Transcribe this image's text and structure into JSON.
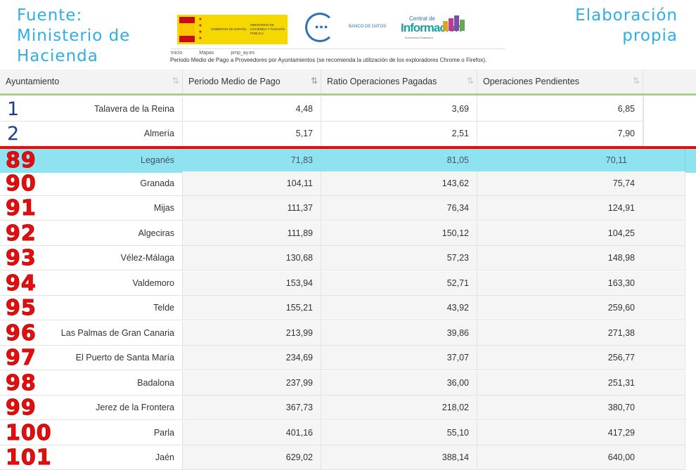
{
  "header": {
    "source_lines": [
      "Fuente:",
      "Ministerio de",
      "Hacienda"
    ],
    "credit_lines": [
      "Elaboración",
      "propia"
    ],
    "gov_logo": {
      "line1": "GOBIERNO DE ESPAÑA",
      "line2": "MINISTERIO DE HACIENDA Y FUNCIÓN PÚBLICA"
    },
    "bank_logo": {
      "label": "BANCO DE DATOS"
    },
    "central_logo": {
      "small": "Central de",
      "big": "Información",
      "sub": "Económico-Financiera"
    },
    "breadcrumbs": [
      "Inicio",
      "Mapas",
      "pmp_ay.es"
    ],
    "subtitle": "Periodo Medio de Pago a Proveedores por Ayuntamientos (se recomienda la utilización de los exploradores Chrome o Firefox)."
  },
  "table": {
    "columns": [
      {
        "label": "Ayuntamiento",
        "sort": "⇅",
        "sort_active": false
      },
      {
        "label": "Periodo Medio de Pago",
        "sort": "⇅",
        "sort_active": true
      },
      {
        "label": "Ratio Operaciones Pagadas",
        "sort": "⇅",
        "sort_active": false
      },
      {
        "label": "Operaciones Pendientes",
        "sort": "⇅",
        "sort_active": false
      }
    ],
    "rows": [
      {
        "rank": "1",
        "name": "Talavera de la Reina",
        "pmp": "4,48",
        "ratio": "3,69",
        "pend": "6,85",
        "style": "top"
      },
      {
        "rank": "2",
        "name": "Almería",
        "pmp": "5,17",
        "ratio": "2,51",
        "pend": "7,90",
        "style": "top"
      },
      {
        "rank": "89",
        "name": "Leganés",
        "pmp": "71,83",
        "ratio": "81,05",
        "pend": "70,11",
        "style": "highlight"
      },
      {
        "rank": "90",
        "name": "Granada",
        "pmp": "104,11",
        "ratio": "143,62",
        "pend": "75,74",
        "style": "red"
      },
      {
        "rank": "91",
        "name": "Mijas",
        "pmp": "111,37",
        "ratio": "76,34",
        "pend": "124,91",
        "style": "red"
      },
      {
        "rank": "92",
        "name": "Algeciras",
        "pmp": "111,89",
        "ratio": "150,12",
        "pend": "104,25",
        "style": "red"
      },
      {
        "rank": "93",
        "name": "Vélez-Málaga",
        "pmp": "130,68",
        "ratio": "57,23",
        "pend": "148,98",
        "style": "red"
      },
      {
        "rank": "94",
        "name": "Valdemoro",
        "pmp": "153,94",
        "ratio": "52,71",
        "pend": "163,30",
        "style": "red"
      },
      {
        "rank": "95",
        "name": "Telde",
        "pmp": "155,21",
        "ratio": "43,92",
        "pend": "259,60",
        "style": "red"
      },
      {
        "rank": "96",
        "name": "Las Palmas de Gran Canaria",
        "pmp": "213,99",
        "ratio": "39,86",
        "pend": "271,38",
        "style": "red"
      },
      {
        "rank": "97",
        "name": "El Puerto de Santa María",
        "pmp": "234,69",
        "ratio": "37,07",
        "pend": "256,77",
        "style": "red"
      },
      {
        "rank": "98",
        "name": "Badalona",
        "pmp": "237,99",
        "ratio": "36,00",
        "pend": "251,31",
        "style": "red"
      },
      {
        "rank": "99",
        "name": "Jerez de la Frontera",
        "pmp": "367,73",
        "ratio": "218,02",
        "pend": "380,70",
        "style": "red"
      },
      {
        "rank": "100",
        "name": "Parla",
        "pmp": "401,16",
        "ratio": "55,10",
        "pend": "417,29",
        "style": "red"
      },
      {
        "rank": "101",
        "name": "Jaén",
        "pmp": "629,02",
        "ratio": "388,14",
        "pend": "640,00",
        "style": "red"
      }
    ]
  },
  "colors": {
    "accent_text": "#2dafe6",
    "highlight_row": "#8fe3f0",
    "rank_red": "#e01010",
    "rank_blue": "#1c3c8c",
    "header_underline": "#a8d08d"
  }
}
